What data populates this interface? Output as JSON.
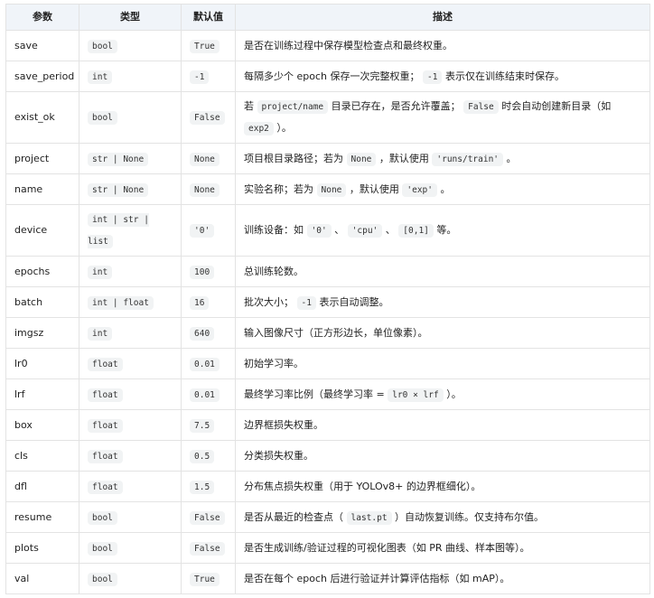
{
  "headers": [
    "参数",
    "类型",
    "默认值",
    "描述"
  ],
  "rows": [
    {
      "param": "save",
      "type": "bool",
      "default": "True",
      "desc": [
        {
          "t": "是否在训练过程中保存模型检查点和最终权重。"
        }
      ]
    },
    {
      "param": "save_period",
      "type": "int",
      "default": "-1",
      "desc": [
        {
          "t": "每隔多少个 epoch 保存一次完整权重； "
        },
        {
          "c": "-1"
        },
        {
          "t": " 表示仅在训练结束时保存。"
        }
      ]
    },
    {
      "param": "exist_ok",
      "type": "bool",
      "default": "False",
      "desc": [
        {
          "t": "若 "
        },
        {
          "c": "project/name"
        },
        {
          "t": " 目录已存在，是否允许覆盖； "
        },
        {
          "c": "False"
        },
        {
          "t": " 时会自动创建新目录（如 "
        },
        {
          "c": "exp2"
        },
        {
          "t": " ）。"
        }
      ]
    },
    {
      "param": "project",
      "type": "str | None",
      "default": "None",
      "desc": [
        {
          "t": "项目根目录路径；若为 "
        },
        {
          "c": "None"
        },
        {
          "t": " ，默认使用 "
        },
        {
          "c": "'runs/train'"
        },
        {
          "t": " 。"
        }
      ]
    },
    {
      "param": "name",
      "type": "str | None",
      "default": "None",
      "desc": [
        {
          "t": "实验名称；若为 "
        },
        {
          "c": "None"
        },
        {
          "t": " ，默认使用 "
        },
        {
          "c": "'exp'"
        },
        {
          "t": " 。"
        }
      ]
    },
    {
      "param": "device",
      "type": "int | str | list",
      "default": "'0'",
      "desc": [
        {
          "t": "训练设备：如 "
        },
        {
          "c": "'0'"
        },
        {
          "t": " 、 "
        },
        {
          "c": "'cpu'"
        },
        {
          "t": " 、 "
        },
        {
          "c": "[0,1]"
        },
        {
          "t": " 等。"
        }
      ]
    },
    {
      "param": "epochs",
      "type": "int",
      "default": "100",
      "desc": [
        {
          "t": "总训练轮数。"
        }
      ]
    },
    {
      "param": "batch",
      "type": "int | float",
      "default": "16",
      "desc": [
        {
          "t": "批次大小； "
        },
        {
          "c": "-1"
        },
        {
          "t": " 表示自动调整。"
        }
      ]
    },
    {
      "param": "imgsz",
      "type": "int",
      "default": "640",
      "desc": [
        {
          "t": "输入图像尺寸（正方形边长，单位像素）。"
        }
      ]
    },
    {
      "param": "lr0",
      "type": "float",
      "default": "0.01",
      "desc": [
        {
          "t": "初始学习率。"
        }
      ]
    },
    {
      "param": "lrf",
      "type": "float",
      "default": "0.01",
      "desc": [
        {
          "t": "最终学习率比例（最终学习率 = "
        },
        {
          "c": "lr0 × lrf"
        },
        {
          "t": " ）。"
        }
      ]
    },
    {
      "param": "box",
      "type": "float",
      "default": "7.5",
      "desc": [
        {
          "t": "边界框损失权重。"
        }
      ]
    },
    {
      "param": "cls",
      "type": "float",
      "default": "0.5",
      "desc": [
        {
          "t": "分类损失权重。"
        }
      ]
    },
    {
      "param": "dfl",
      "type": "float",
      "default": "1.5",
      "desc": [
        {
          "t": "分布焦点损失权重（用于 YOLOv8+ 的边界框细化）。"
        }
      ]
    },
    {
      "param": "resume",
      "type": "bool",
      "default": "False",
      "desc": [
        {
          "t": "是否从最近的检查点（ "
        },
        {
          "c": "last.pt"
        },
        {
          "t": " ）自动恢复训练。仅支持布尔值。"
        }
      ]
    },
    {
      "param": "plots",
      "type": "bool",
      "default": "False",
      "desc": [
        {
          "t": "是否生成训练/验证过程的可视化图表（如 PR 曲线、样本图等）。"
        }
      ]
    },
    {
      "param": "val",
      "type": "bool",
      "default": "True",
      "desc": [
        {
          "t": "是否在每个 epoch 后进行验证并计算评估指标（如 mAP）。"
        }
      ]
    }
  ]
}
